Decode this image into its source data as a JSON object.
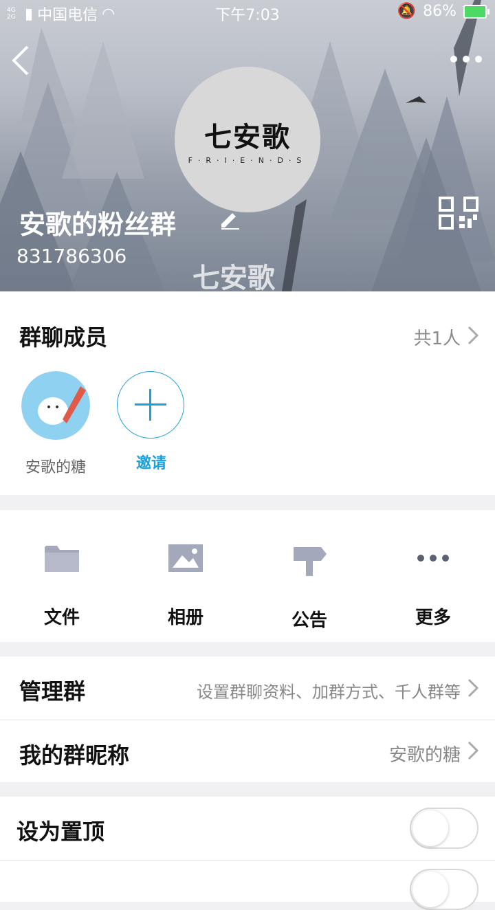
{
  "status_bar": {
    "network": "4G 2G",
    "carrier": "中国电信",
    "time": "下午7:03",
    "battery": "86%"
  },
  "header": {
    "avatar_logo_main": "七安歌",
    "avatar_logo_sub": "F·R·I·E·N·D·S",
    "group_name": "安歌的粉丝群",
    "group_id": "831786306",
    "watermark": "七安歌"
  },
  "members": {
    "title": "群聊成员",
    "count_label": "共1人",
    "list": [
      {
        "name": "安歌的糖"
      }
    ],
    "invite_label": "邀请"
  },
  "tools": [
    {
      "label": "文件",
      "icon": "folder-icon"
    },
    {
      "label": "相册",
      "icon": "image-icon"
    },
    {
      "label": "公告",
      "icon": "signpost-icon"
    },
    {
      "label": "更多",
      "icon": "more-icon"
    }
  ],
  "settings": {
    "manage_title": "管理群",
    "manage_desc": "设置群聊资料、加群方式、千人群等",
    "nickname_title": "我的群昵称",
    "nickname_value": "安歌的糖",
    "pin_title": "设为置顶",
    "pin_on": false
  },
  "colors": {
    "accent": "#1aa0db",
    "icon_gray": "#a3a8bb"
  }
}
